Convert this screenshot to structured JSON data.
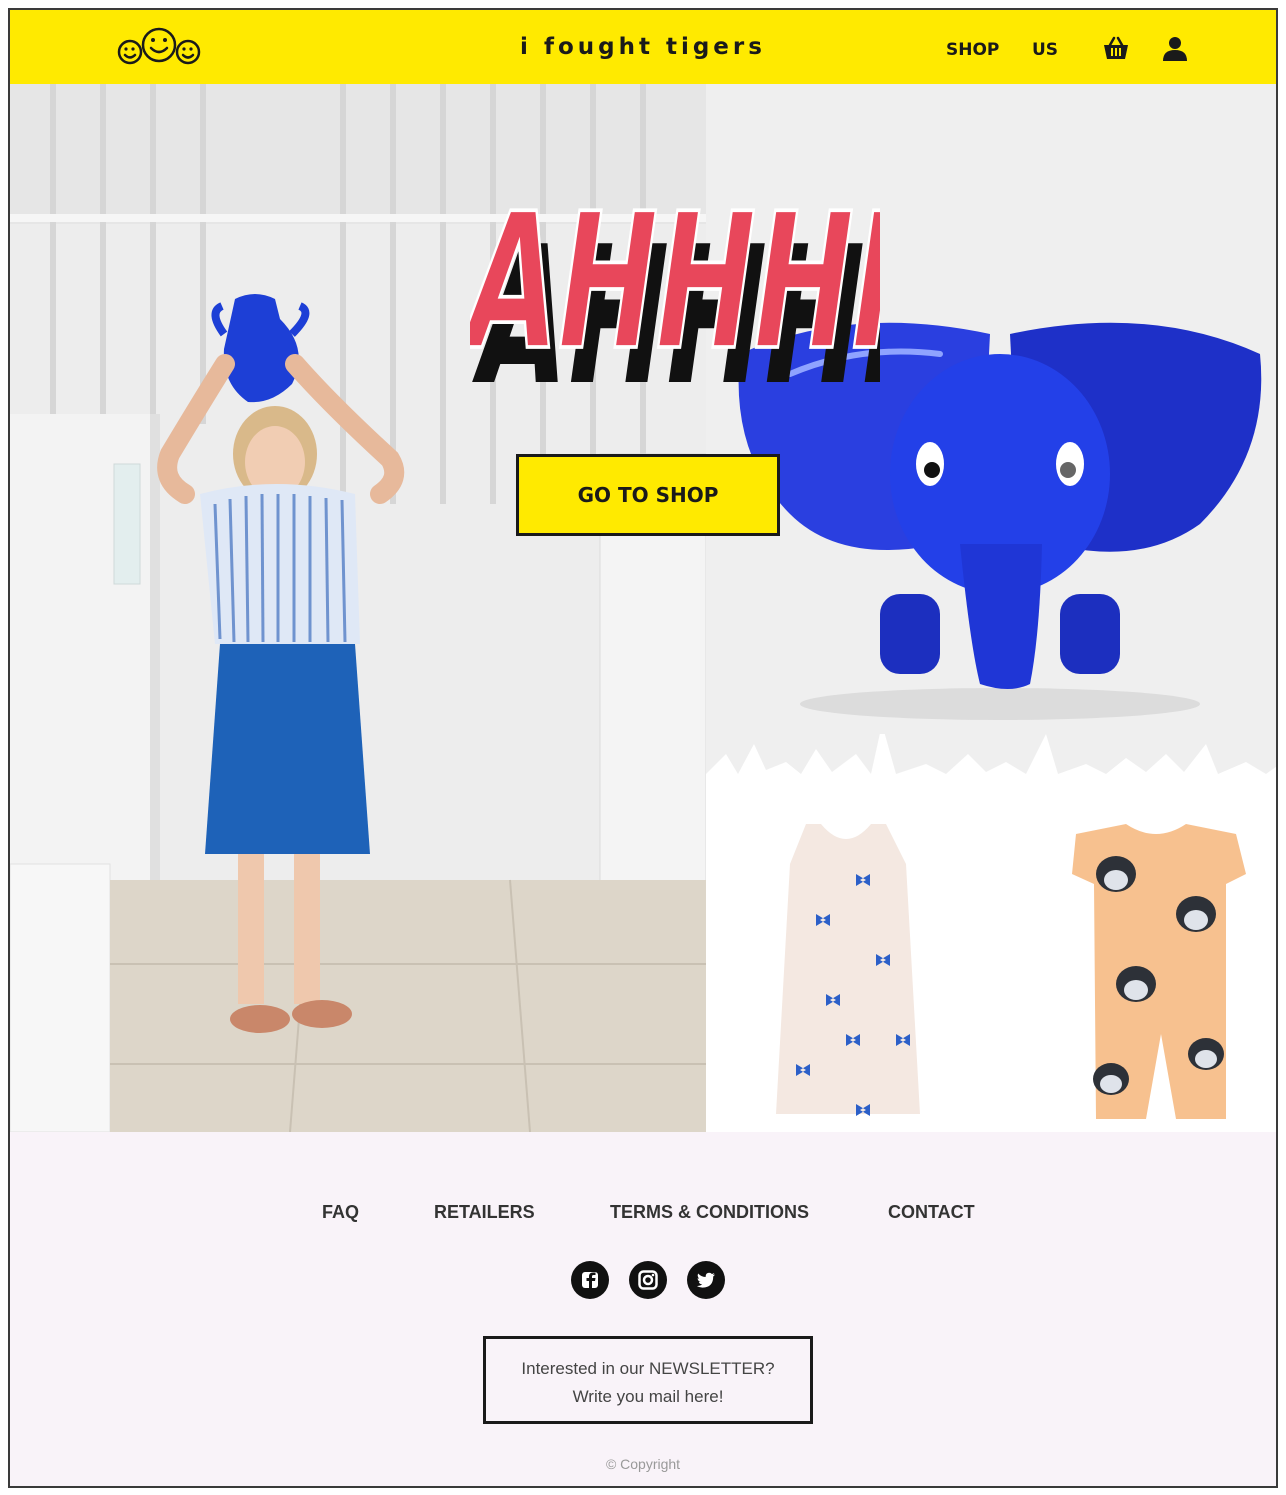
{
  "header": {
    "brand": "i fought tigers",
    "nav": {
      "shop": "SHOP",
      "us": "US"
    },
    "icons": [
      "smiley-faces-logo",
      "basket-icon",
      "user-icon"
    ],
    "background": "#ffea00"
  },
  "hero": {
    "headline_graphic": "AHHHH!",
    "cta_label": "GO TO SHOP",
    "images": [
      "girl-with-blue-vase-photo",
      "blue-inflatable-elephant-photo",
      "bow-print-dress-photo",
      "dog-print-romper-photo"
    ]
  },
  "footer": {
    "links": [
      "FAQ",
      "RETAILERS",
      "TERMS & CONDITIONS",
      "CONTACT"
    ],
    "social": [
      "facebook-icon",
      "instagram-icon",
      "twitter-icon"
    ],
    "newsletter": {
      "line1": "Interested in our NEWSLETTER?",
      "line2": "Write you mail here!"
    },
    "copyright": "© Copyright"
  }
}
